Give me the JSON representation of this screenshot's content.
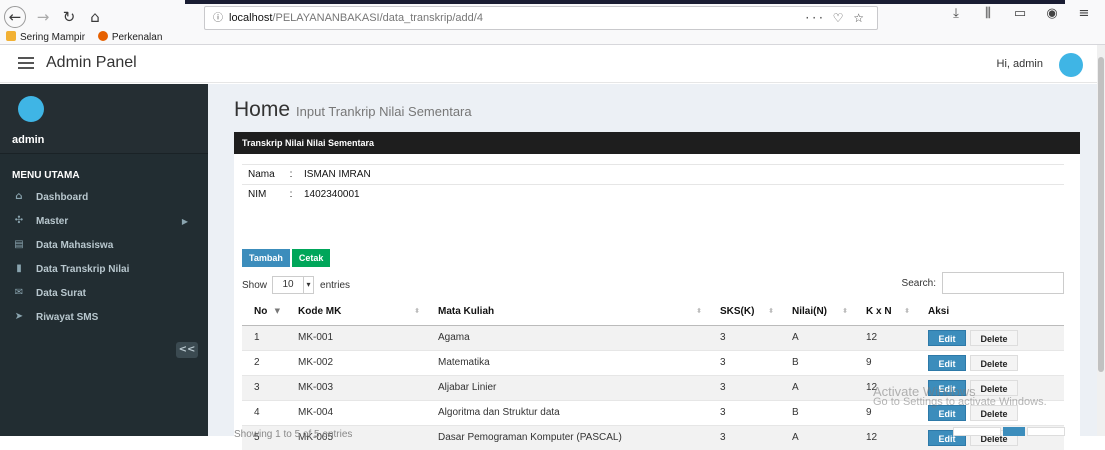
{
  "browser": {
    "url_host": "localhost",
    "url_path": "/PELAYANANBAKASI/data_transkrip/add/4",
    "url_actions": "··· ♡ ☆",
    "bookmarks": [
      "Sering Mampir",
      "Perkenalan"
    ]
  },
  "header": {
    "title": "Admin Panel",
    "greeting": "Hi, admin"
  },
  "sidebar": {
    "username": "admin",
    "menu_header": "MENU UTAMA",
    "items": [
      {
        "label": "Dashboard",
        "icon": "home-icon"
      },
      {
        "label": "Master",
        "icon": "fan-icon"
      },
      {
        "label": "Data Mahasiswa",
        "icon": "id-card-icon"
      },
      {
        "label": "Data Transkrip Nilai",
        "icon": "file-icon"
      },
      {
        "label": "Data Surat",
        "icon": "envelope-icon"
      },
      {
        "label": "Riwayat SMS",
        "icon": "send-icon"
      }
    ],
    "collapse_label": "<<"
  },
  "page": {
    "title": "Home",
    "subtitle": "Input Trankrip Nilai Sementara",
    "box_title": "Transkrip Nilai Nilai Sementara"
  },
  "student": {
    "name_label": "Nama",
    "name_value": "ISMAN IMRAN",
    "nim_label": "NIM",
    "nim_value": "1402340001",
    "colon": ":"
  },
  "buttons": {
    "tambah": "Tambah",
    "cetak": "Cetak"
  },
  "table_controls": {
    "show": "Show",
    "entries_value": "10",
    "entries": "entries",
    "search": "Search:"
  },
  "table": {
    "headers": [
      "No",
      "Kode MK",
      "Mata Kuliah",
      "SKS(K)",
      "Nilai(N)",
      "K x N",
      "Aksi"
    ],
    "rows": [
      {
        "no": "1",
        "kode": "MK-001",
        "mk": "Agama",
        "sks": "3",
        "nilai": "A",
        "kxn": "12"
      },
      {
        "no": "2",
        "kode": "MK-002",
        "mk": "Matematika",
        "sks": "3",
        "nilai": "B",
        "kxn": "9"
      },
      {
        "no": "3",
        "kode": "MK-003",
        "mk": "Aljabar Linier",
        "sks": "3",
        "nilai": "A",
        "kxn": "12"
      },
      {
        "no": "4",
        "kode": "MK-004",
        "mk": "Algoritma dan Struktur data",
        "sks": "3",
        "nilai": "B",
        "kxn": "9"
      },
      {
        "no": "5",
        "kode": "MK-005",
        "mk": "Dasar Pemograman Komputer (PASCAL)",
        "sks": "3",
        "nilai": "A",
        "kxn": "12"
      }
    ],
    "edit_label": "Edit",
    "delete_label": "Delete",
    "footer": "Showing 1 to 5 of 5 entries"
  },
  "watermark": {
    "line1": "Activate Windows",
    "line2": "Go to Settings to activate Windows."
  },
  "colors": {
    "sidebar": "#222d32",
    "accent_blue": "#3c8dbc",
    "accent_green": "#00a65a",
    "box_header": "#1e1e1e"
  }
}
